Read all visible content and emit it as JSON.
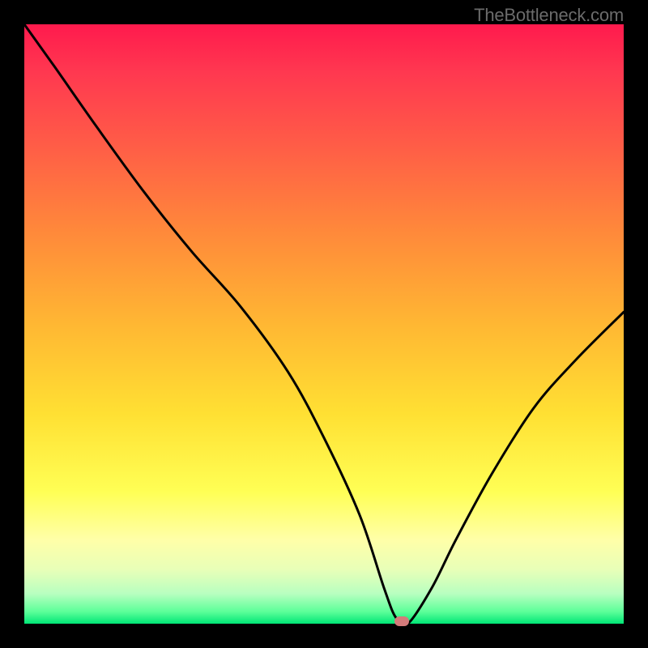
{
  "watermark": "TheBottleneck.com",
  "chart_data": {
    "type": "line",
    "title": "",
    "xlabel": "",
    "ylabel": "",
    "xlim": [
      0,
      100
    ],
    "ylim": [
      0,
      100
    ],
    "series": [
      {
        "name": "curve",
        "x": [
          0,
          5,
          12,
          20,
          28,
          36,
          44,
          50,
          56,
          60,
          62,
          64,
          68,
          72,
          78,
          85,
          92,
          100
        ],
        "values": [
          100,
          93,
          83,
          72,
          62,
          53,
          42,
          31,
          18,
          6,
          1,
          0,
          6,
          14,
          25,
          36,
          44,
          52
        ]
      }
    ],
    "marker": {
      "x": 63,
      "y": 0,
      "color": "#d37a7a"
    },
    "gradient_stops": [
      {
        "pos": 0,
        "color": "#ff1a4d"
      },
      {
        "pos": 50,
        "color": "#ffb733"
      },
      {
        "pos": 78,
        "color": "#ffff55"
      },
      {
        "pos": 100,
        "color": "#00e676"
      }
    ]
  }
}
